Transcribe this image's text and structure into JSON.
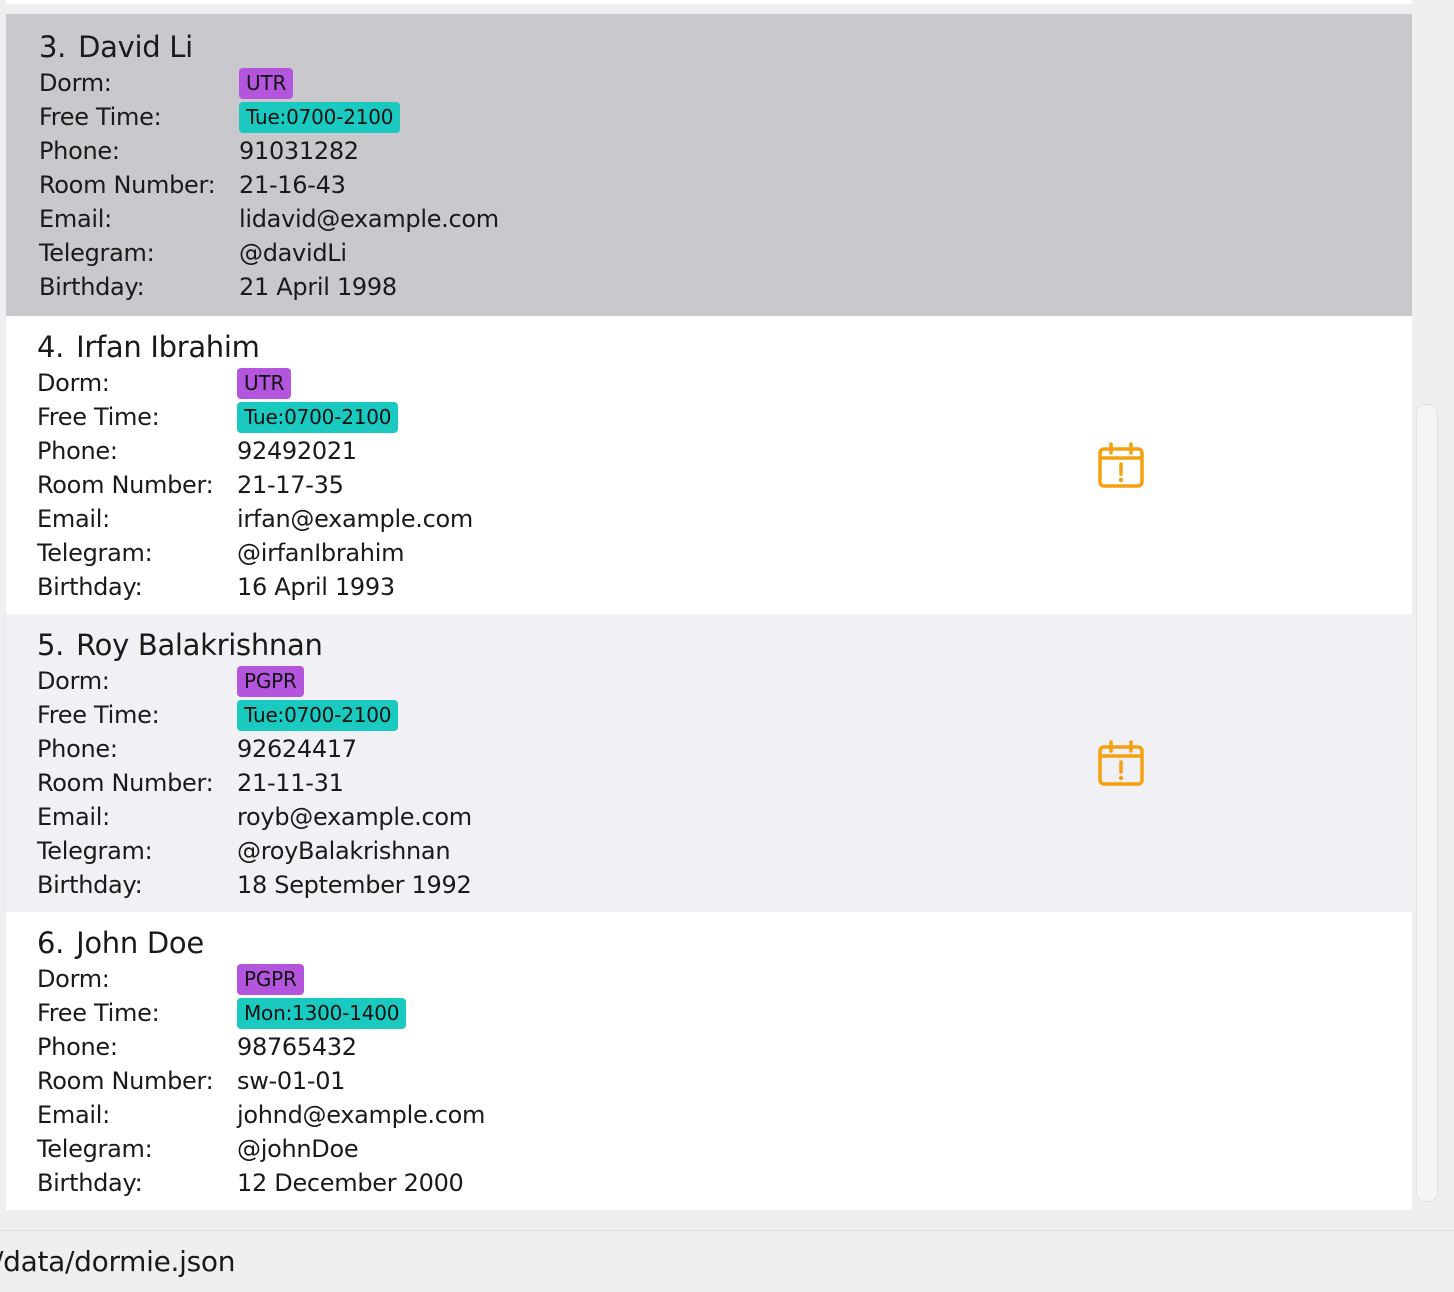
{
  "labels": {
    "dorm": "Dorm:",
    "free_time": "Free Time:",
    "phone": "Phone:",
    "room_number": "Room Number:",
    "email": "Email:",
    "telegram": "Telegram:",
    "birthday": "Birthday:"
  },
  "persons": [
    {
      "index": "3.",
      "name": "David Li",
      "dorm": "UTR",
      "free_time": "Tue:0700-2100",
      "phone": "91031282",
      "room_number": "21-16-43",
      "email": "lidavid@example.com",
      "telegram": "@davidLi",
      "birthday": "21 April 1998",
      "selected": true,
      "icon": null
    },
    {
      "index": "4.",
      "name": "Irfan Ibrahim",
      "dorm": "UTR",
      "free_time": "Tue:0700-2100",
      "phone": "92492021",
      "room_number": "21-17-35",
      "email": "irfan@example.com",
      "telegram": "@irfanIbrahim",
      "birthday": "16 April 1993",
      "selected": false,
      "icon": "calendar-alert-icon"
    },
    {
      "index": "5.",
      "name": "Roy Balakrishnan",
      "dorm": "PGPR",
      "free_time": "Tue:0700-2100",
      "phone": "92624417",
      "room_number": "21-11-31",
      "email": "royb@example.com",
      "telegram": "@royBalakrishnan",
      "birthday": "18 September 1992",
      "selected": false,
      "icon": "calendar-alert-icon"
    },
    {
      "index": "6.",
      "name": "John Doe",
      "dorm": "PGPR",
      "free_time": "Mon:1300-1400",
      "phone": "98765432",
      "room_number": "sw-01-01",
      "email": "johnd@example.com",
      "telegram": "@johnDoe",
      "birthday": "12 December 2000",
      "selected": false,
      "icon": null
    }
  ],
  "status_bar": {
    "file_path": "/data/dormie.json"
  },
  "colors": {
    "selected_card": "#c8c8cd",
    "alt_card": "#f1f1f5",
    "dorm_tag": "#b455dd",
    "free_time_tag": "#1ac9bf",
    "alert_icon": "#f5a00f"
  }
}
